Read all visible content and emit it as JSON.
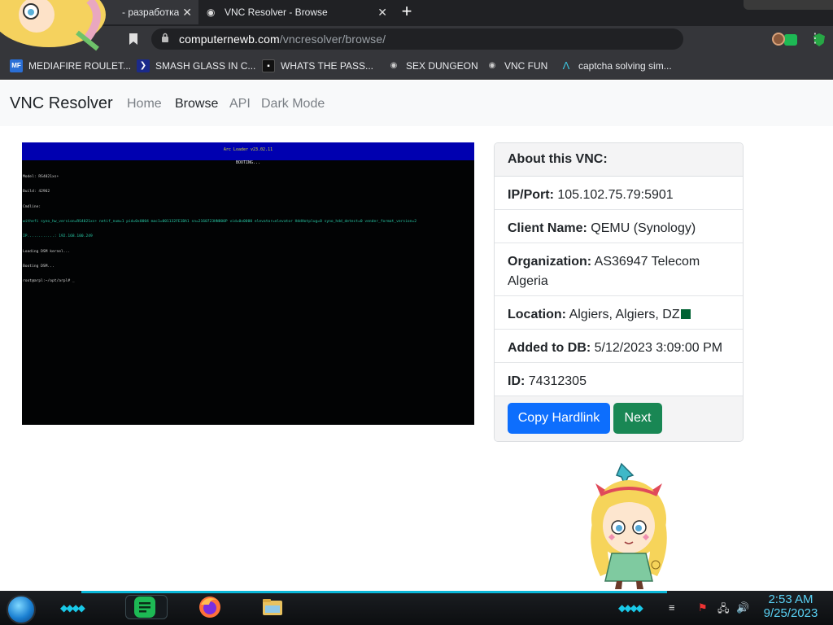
{
  "browser": {
    "tabs": [
      {
        "label": "- разработка",
        "close": "✕"
      },
      {
        "label": "VNC Resolver - Browse",
        "close": "✕"
      }
    ],
    "new_tab": "+",
    "address": {
      "host": "computernewb.com",
      "path": "/vncresolver/browse/"
    },
    "menu": "⋮",
    "bookmarks": [
      {
        "label": "MEDIAFIRE ROULET...",
        "icon": "MF",
        "icon_color": "#2a6fd6"
      },
      {
        "label": "SMASH GLASS IN C...",
        "icon": "chevron-logo",
        "icon_color": "#2a4be0"
      },
      {
        "label": "WHATS THE PASS...",
        "icon": "black-square-logo",
        "icon_color": "#111111"
      },
      {
        "label": "SEX DUNGEON",
        "icon": "vnc-eye-logo",
        "icon_color": "#cccccc"
      },
      {
        "label": "VNC FUN",
        "icon": "vnc-eye-logo",
        "icon_color": "#cccccc"
      },
      {
        "label": "captcha solving sim...",
        "icon": "caret-logo",
        "icon_color": "#3cc6e0"
      }
    ]
  },
  "navbar": {
    "brand": "VNC Resolver",
    "links": [
      "Home",
      "Browse",
      "API",
      "Dark Mode"
    ],
    "active": "Browse"
  },
  "vnc_screen": {
    "header": "Arc Loader v23.02.11",
    "subheader": "BOOTING...",
    "lines": [
      "Model: RS4021xs+",
      "Build: 42962",
      "Cmdline:",
      "withefi syno_hw_version=RS4021xs+ netif_num=1 pid=0x0004 mac1=001132FE1BA1 sn=2160723HN800P vid=0x0000 elevator=elevator HddHotplug=0 syno_hdd_detect=0 vender_format_version=2",
      "IP............: 192.168.100.249",
      "Loading DSM kernel...",
      "Booting DSM...",
      "root@arpl:~/opt/arpl# _"
    ]
  },
  "card": {
    "header": "About this VNC:",
    "fields": [
      {
        "label": "IP/Port:",
        "value": "105.102.75.79:5901"
      },
      {
        "label": "Client Name:",
        "value": "QEMU (Synology)"
      },
      {
        "label": "Organization:",
        "value": "AS36947 Telecom Algeria"
      },
      {
        "label": "Location:",
        "value": "Algiers, Algiers, DZ"
      },
      {
        "label": "Added to DB:",
        "value": "5/12/2023 3:09:00 PM"
      },
      {
        "label": "ID:",
        "value": "74312305"
      }
    ],
    "buttons": {
      "copy": "Copy Hardlink",
      "next": "Next"
    },
    "flag_color": "#006233"
  },
  "taskbar": {
    "time": "2:53 AM",
    "date": "9/25/2023",
    "accent": "#19c9e8"
  }
}
